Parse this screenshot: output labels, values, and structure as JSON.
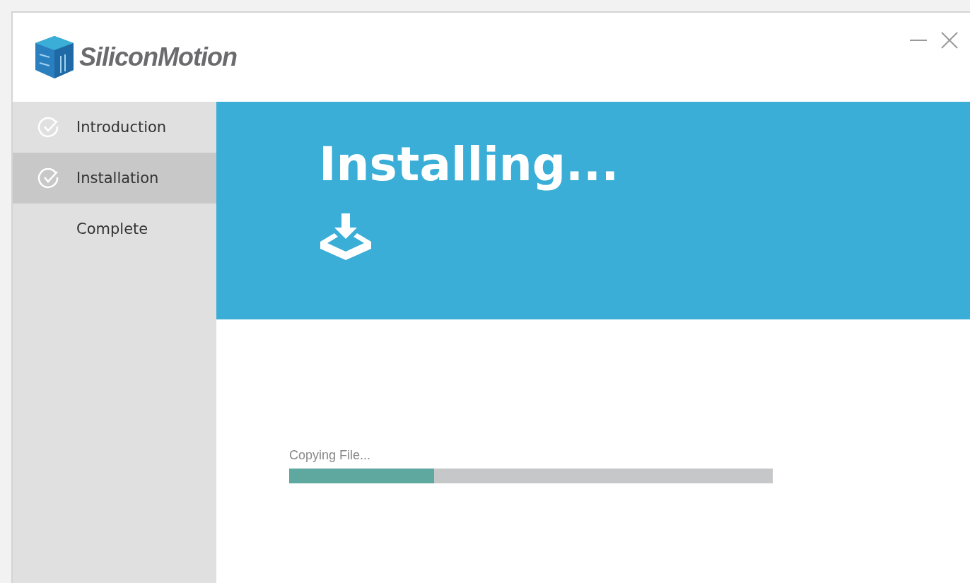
{
  "logo": {
    "text": "SiliconMotion"
  },
  "steps": [
    {
      "label": "Introduction",
      "checked": true,
      "selected": false
    },
    {
      "label": "Installation",
      "checked": true,
      "selected": true
    },
    {
      "label": "Complete",
      "checked": false,
      "selected": false
    }
  ],
  "banner": {
    "title": "Installing..."
  },
  "progress": {
    "label": "Copying File...",
    "level": 0.3
  }
}
